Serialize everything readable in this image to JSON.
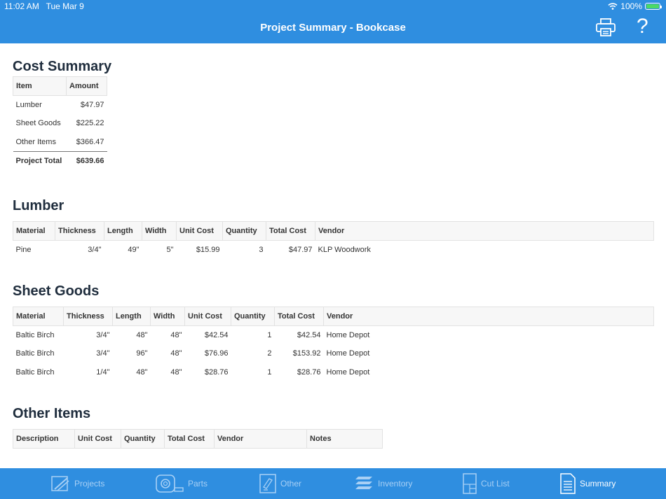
{
  "status": {
    "time": "11:02 AM",
    "date": "Tue Mar 9",
    "battery": "100%"
  },
  "header": {
    "title": "Project Summary - Bookcase"
  },
  "cost_summary": {
    "title": "Cost Summary",
    "columns": [
      "Item",
      "Amount"
    ],
    "rows": [
      [
        "Lumber",
        "$47.97"
      ],
      [
        "Sheet Goods",
        "$225.22"
      ],
      [
        "Other Items",
        "$366.47"
      ]
    ],
    "total": [
      "Project Total",
      "$639.66"
    ]
  },
  "lumber": {
    "title": "Lumber",
    "columns": [
      "Material",
      "Thickness",
      "Length",
      "Width",
      "Unit Cost",
      "Quantity",
      "Total Cost",
      "Vendor"
    ],
    "rows": [
      [
        "Pine",
        "3/4\"",
        "49\"",
        "5\"",
        "$15.99",
        "3",
        "$47.97",
        "KLP Woodwork"
      ]
    ]
  },
  "sheet_goods": {
    "title": "Sheet Goods",
    "columns": [
      "Material",
      "Thickness",
      "Length",
      "Width",
      "Unit Cost",
      "Quantity",
      "Total Cost",
      "Vendor"
    ],
    "rows": [
      [
        "Baltic Birch",
        "3/4\"",
        "48\"",
        "48\"",
        "$42.54",
        "1",
        "$42.54",
        "Home Depot"
      ],
      [
        "Baltic Birch",
        "3/4\"",
        "96\"",
        "48\"",
        "$76.96",
        "2",
        "$153.92",
        "Home Depot"
      ],
      [
        "Baltic Birch",
        "1/4\"",
        "48\"",
        "48\"",
        "$28.76",
        "1",
        "$28.76",
        "Home Depot"
      ]
    ]
  },
  "other_items": {
    "title": "Other Items",
    "columns": [
      "Description",
      "Unit Cost",
      "Quantity",
      "Total Cost",
      "Vendor",
      "Notes"
    ]
  },
  "tabs": [
    {
      "label": "Projects",
      "icon": "projects-icon"
    },
    {
      "label": "Parts",
      "icon": "tape-measure-icon"
    },
    {
      "label": "Other",
      "icon": "other-icon"
    },
    {
      "label": "Inventory",
      "icon": "layers-icon"
    },
    {
      "label": "Cut List",
      "icon": "cut-list-icon"
    },
    {
      "label": "Summary",
      "icon": "summary-icon"
    }
  ],
  "colors": {
    "accent": "#2f8ee0",
    "tab_inactive": "#a8d0f5"
  }
}
